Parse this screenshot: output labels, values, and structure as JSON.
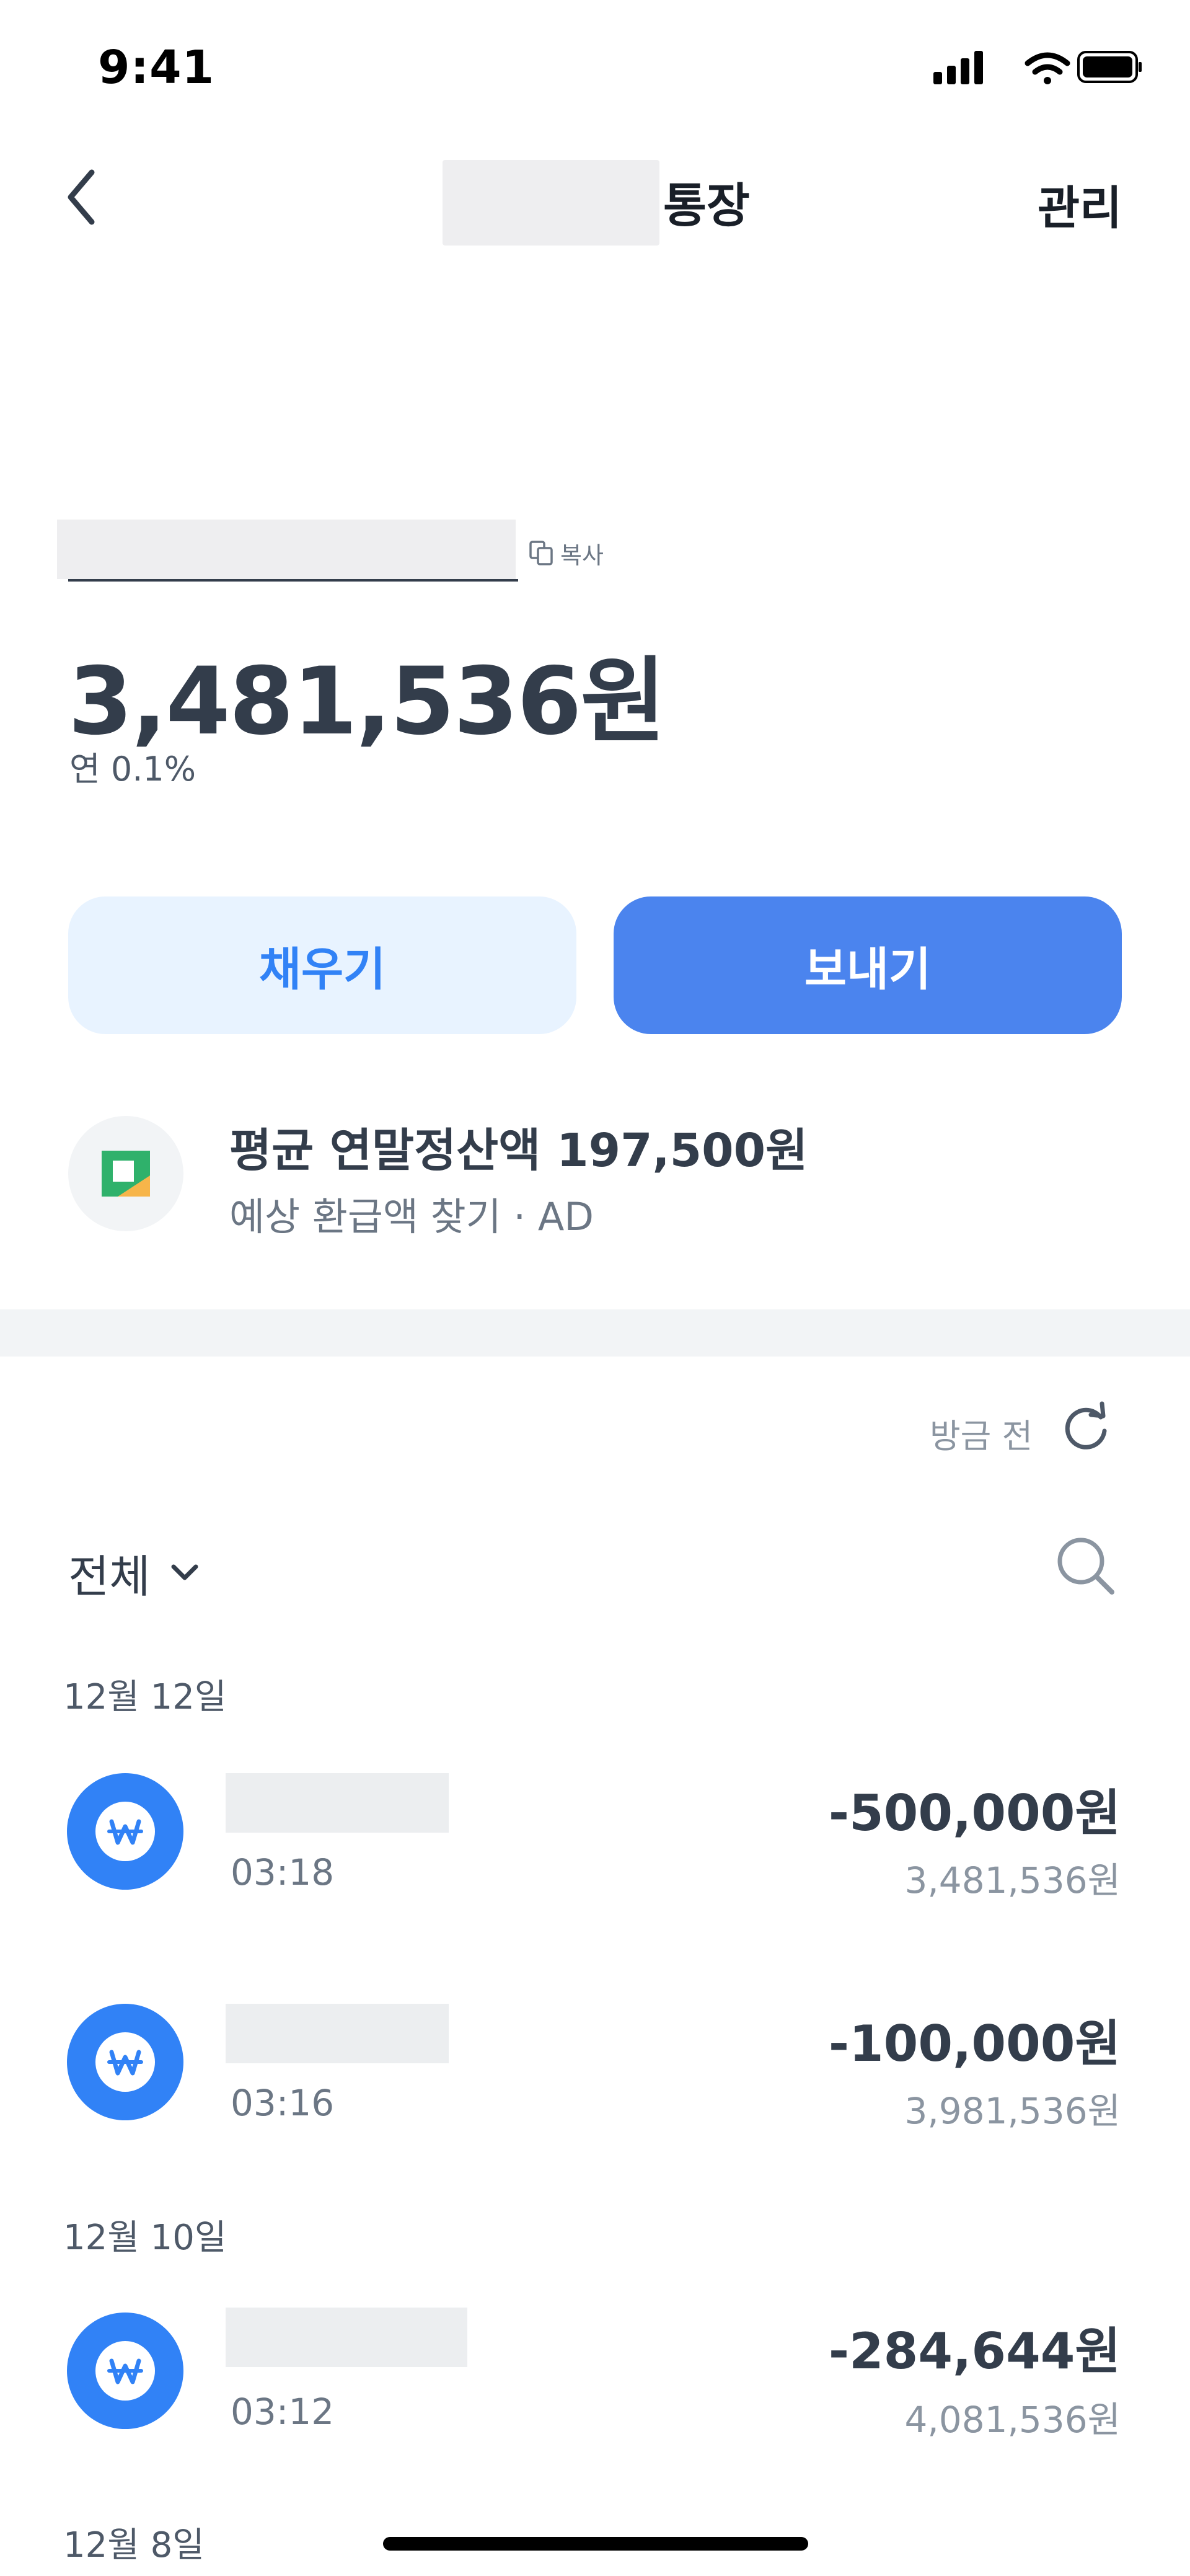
{
  "status_bar": {
    "time": "9:41",
    "icons": [
      "cellular-signal-icon",
      "wifi-icon",
      "battery-icon"
    ]
  },
  "header": {
    "title_suffix": "통장",
    "manage_label": "관리",
    "back_icon": "chevron-left-icon"
  },
  "account": {
    "copy_label": "복사",
    "balance": "3,481,536원",
    "rate": "연 0.1%"
  },
  "actions": {
    "fill_label": "채우기",
    "send_label": "보내기"
  },
  "ad": {
    "title": "평균 연말정산액 197,500원",
    "subtitle": "예상 환급액 찾기 · AD"
  },
  "history": {
    "refresh_label": "방금 전",
    "filter_label": "전체",
    "groups": [
      {
        "date": "12월 12일",
        "items": [
          {
            "time": "03:18",
            "amount": "-500,000원",
            "balance": "3,481,536원"
          },
          {
            "time": "03:16",
            "amount": "-100,000원",
            "balance": "3,981,536원"
          }
        ]
      },
      {
        "date": "12월 10일",
        "items": [
          {
            "time": "03:12",
            "amount": "-284,644원",
            "balance": "4,081,536원"
          }
        ]
      },
      {
        "date": "12월 8일",
        "items": []
      }
    ]
  },
  "colors": {
    "primary": "#3182f6",
    "send_button": "#4b84ee",
    "fill_button_bg": "#e8f3ff",
    "text_dark": "#333d4b",
    "text_gray": "#8b95a1",
    "divider": "#f2f4f6"
  }
}
